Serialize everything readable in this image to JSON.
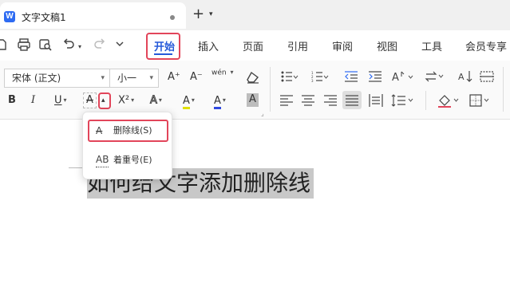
{
  "tab": {
    "logo": "W",
    "title": "文字文稿1",
    "new_tab": "+",
    "new_tab_caret": "⌄"
  },
  "quick_access": {
    "file_icon": "folder-icon",
    "print_icon": "printer-icon",
    "preview_icon": "print-preview-icon",
    "undo_icon": "undo-icon",
    "redo_icon": "redo-icon",
    "more_icon": "chevron-down-icon"
  },
  "menu": [
    {
      "label": "开始",
      "active": true
    },
    {
      "label": "插入"
    },
    {
      "label": "页面"
    },
    {
      "label": "引用"
    },
    {
      "label": "审阅"
    },
    {
      "label": "视图"
    },
    {
      "label": "工具"
    },
    {
      "label": "会员专享"
    }
  ],
  "ribbon": {
    "font_name": "宋体 (正文)",
    "font_size": "小一",
    "grow_font": "A⁺",
    "shrink_font": "A⁻",
    "phonetic": "wén",
    "bold": "B",
    "italic": "I",
    "underline": "U",
    "strikethrough": "A̶",
    "superscript": "X²",
    "effects": "A",
    "highlight": "A",
    "font_color": "A",
    "char_shading": "A"
  },
  "dropdown": {
    "items": [
      {
        "icon": "A̶",
        "label": "删除线(S)"
      },
      {
        "icon": "AB",
        "label": "着重号(E)"
      }
    ]
  },
  "document": {
    "text": "如何给文字添加删除线"
  },
  "colors": {
    "accent": "#2559d9",
    "highlight_box": "#e2455a",
    "font_color_bar": "#2f48e0",
    "selection": "#c8c8c8"
  }
}
